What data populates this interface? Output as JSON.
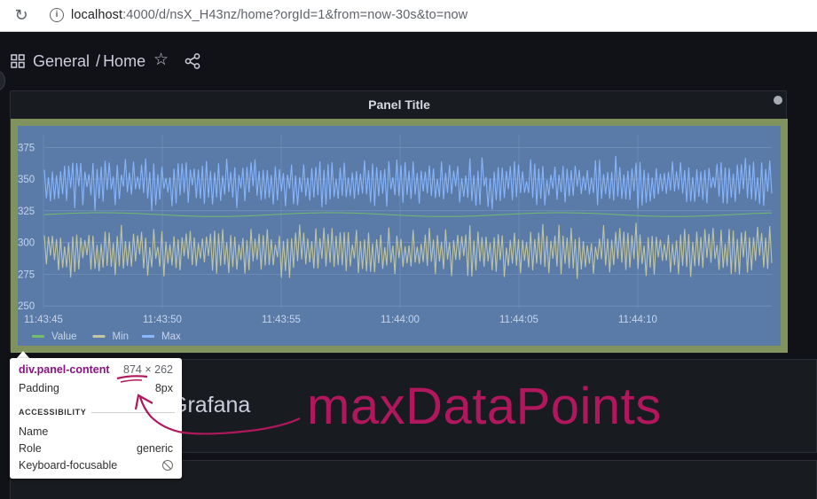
{
  "browser": {
    "url_host": "localhost",
    "url_rest": ":4000/d/nsX_H43nz/home?orgId=1&from=now-30s&to=now"
  },
  "header": {
    "folder": "General",
    "separator": "/",
    "dashboard": "Home"
  },
  "panel": {
    "title": "Panel Title"
  },
  "chart_data": {
    "type": "line",
    "x_ticks": [
      "11:43:45",
      "11:43:50",
      "11:43:55",
      "11:44:00",
      "11:44:05",
      "11:44:10"
    ],
    "y_ticks": [
      375,
      350,
      325,
      300,
      275,
      250
    ],
    "ylim": [
      248,
      385
    ],
    "legend_placement": "bottom-left",
    "grid": true,
    "series": [
      {
        "name": "Value",
        "color": "#73bf69",
        "level": 322,
        "amplitude": 0,
        "noise": 1.5
      },
      {
        "name": "Min",
        "color": "#c5c9a3",
        "level": 293,
        "amplitude": 18,
        "noise": 10
      },
      {
        "name": "Max",
        "color": "#8ab8ff",
        "level": 347,
        "amplitude": 17,
        "noise": 10
      }
    ],
    "points": 360
  },
  "panel2": {
    "text": "Grafana"
  },
  "tooltip": {
    "selector": "div.panel-content",
    "size": "874 × 262",
    "padding_label": "Padding",
    "padding_value": "8px",
    "section": "ACCESSIBILITY",
    "name_label": "Name",
    "role_label": "Role",
    "role_value": "generic",
    "focus_label": "Keyboard-focusable"
  },
  "annotation": {
    "text": "maxDataPoints",
    "color": "#b1175d"
  }
}
